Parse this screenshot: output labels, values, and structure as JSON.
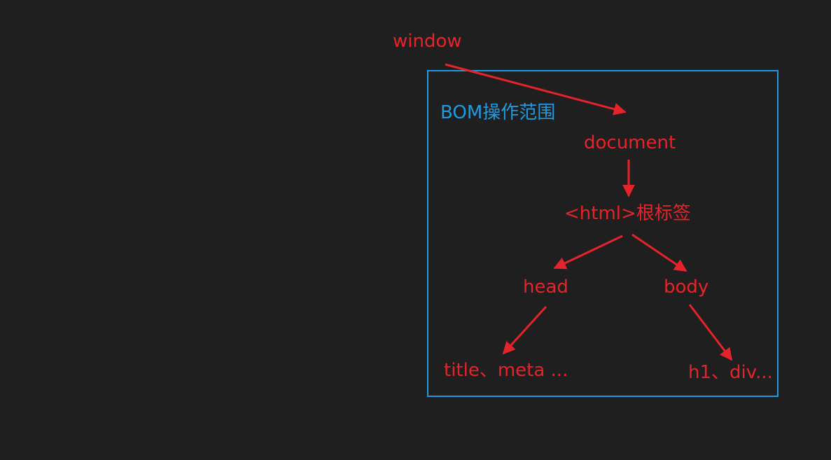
{
  "colors": {
    "background": "#1f1f1f",
    "tree_red": "#e5232a",
    "scope_blue": "#1e9be0"
  },
  "scope": {
    "label": "BOM操作范围"
  },
  "nodes": {
    "window": "window",
    "document": "document",
    "html": "<html>根标签",
    "head": "head",
    "body": "body",
    "head_children": "title、meta ...",
    "body_children": "h1、div..."
  },
  "edges": [
    {
      "from": "window",
      "to": "document"
    },
    {
      "from": "document",
      "to": "html"
    },
    {
      "from": "html",
      "to": "head"
    },
    {
      "from": "html",
      "to": "body"
    },
    {
      "from": "head",
      "to": "head_children"
    },
    {
      "from": "body",
      "to": "body_children"
    }
  ]
}
